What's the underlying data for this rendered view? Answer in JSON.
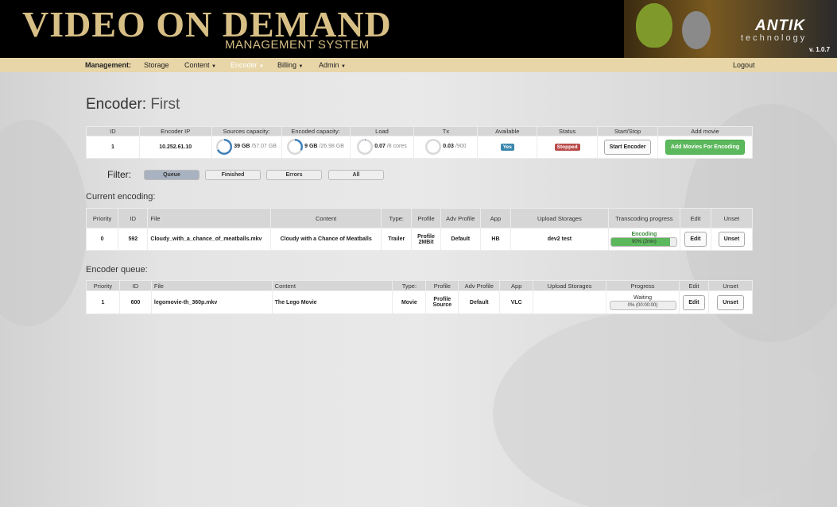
{
  "header": {
    "logo_title": "VIDEO ON DEMAND",
    "logo_subtitle": "MANAGEMENT SYSTEM",
    "brand_name": "ANTIK",
    "brand_subtitle": "technology",
    "version": "v. 1.0.7"
  },
  "nav": {
    "label": "Management:",
    "items": [
      "Storage",
      "Content",
      "Encoder",
      "Billing",
      "Admin"
    ],
    "active": "Encoder",
    "logout": "Logout"
  },
  "page": {
    "title_prefix": "Encoder:",
    "title_name": "First"
  },
  "encoder_table": {
    "headers": [
      "ID",
      "Encoder IP",
      "Sources capacity:",
      "Encoded capacity:",
      "Load",
      "Tx",
      "Available",
      "Status",
      "Start/Stop",
      "Add movie"
    ],
    "row": {
      "id": "1",
      "ip": "10.252.61.10",
      "sources_used": "39 GB",
      "sources_total": "/57.07 GB",
      "sources_fraction": 0.68,
      "encoded_used": "9 GB",
      "encoded_total": "/26.98 GB",
      "encoded_fraction": 0.33,
      "load_value": "0.07",
      "load_total": "/8 cores",
      "load_fraction": 0.01,
      "tx_value": "0.03",
      "tx_total": "/900",
      "tx_fraction": 0.0,
      "available": "Yes",
      "status": "Stopped",
      "start_button": "Start Encoder",
      "add_button": "Add Movies For Encoding"
    }
  },
  "filter": {
    "label": "Filter:",
    "buttons": [
      "Queue",
      "Finished",
      "Errors",
      "All"
    ],
    "active": "Queue"
  },
  "current_encoding": {
    "title": "Current encoding:",
    "headers": [
      "Priority",
      "ID",
      "File",
      "Content",
      "Type:",
      "Profile",
      "Adv Profile",
      "App",
      "Upload Storages",
      "Transcoding progress",
      "Edit",
      "Unset"
    ],
    "rows": [
      {
        "priority": "0",
        "id": "592",
        "file": "Cloudy_with_a_chance_of_meatballs.mkv",
        "content": "Cloudy with a Chance of Meatballs",
        "type": "Trailer",
        "profile": "Profile 2MBit",
        "adv_profile": "Default",
        "app": "HB",
        "upload_storages": "dev2 test",
        "status": "Encoding",
        "progress_text": "90% (2min)",
        "progress": 0.9,
        "edit": "Edit",
        "unset": "Unset"
      }
    ]
  },
  "encoder_queue": {
    "title": "Encoder queue:",
    "headers": [
      "Priority",
      "ID",
      "File",
      "Content",
      "Type:",
      "Profile",
      "Adv Profile",
      "App",
      "Upload Storages",
      "Progress",
      "Edit",
      "Unset"
    ],
    "rows": [
      {
        "priority": "1",
        "id": "600",
        "file": "legomovie-th_360p.mkv",
        "content": "The Lego Movie",
        "type": "Movie",
        "profile": "Profile Source",
        "adv_profile": "Default",
        "app": "VLC",
        "upload_storages": "",
        "status": "Waiting",
        "progress_text": "0% (00:00:00)",
        "progress": 0.0,
        "edit": "Edit",
        "unset": "Unset"
      }
    ]
  },
  "colors": {
    "nav_bg": "#e8d6a8",
    "logo_gold": "#d7bf86",
    "available_label": "#3a87ad",
    "stopped_label": "#b94a48",
    "green_button": "#5cb85c",
    "donut_blue": "#3f7fb8"
  }
}
